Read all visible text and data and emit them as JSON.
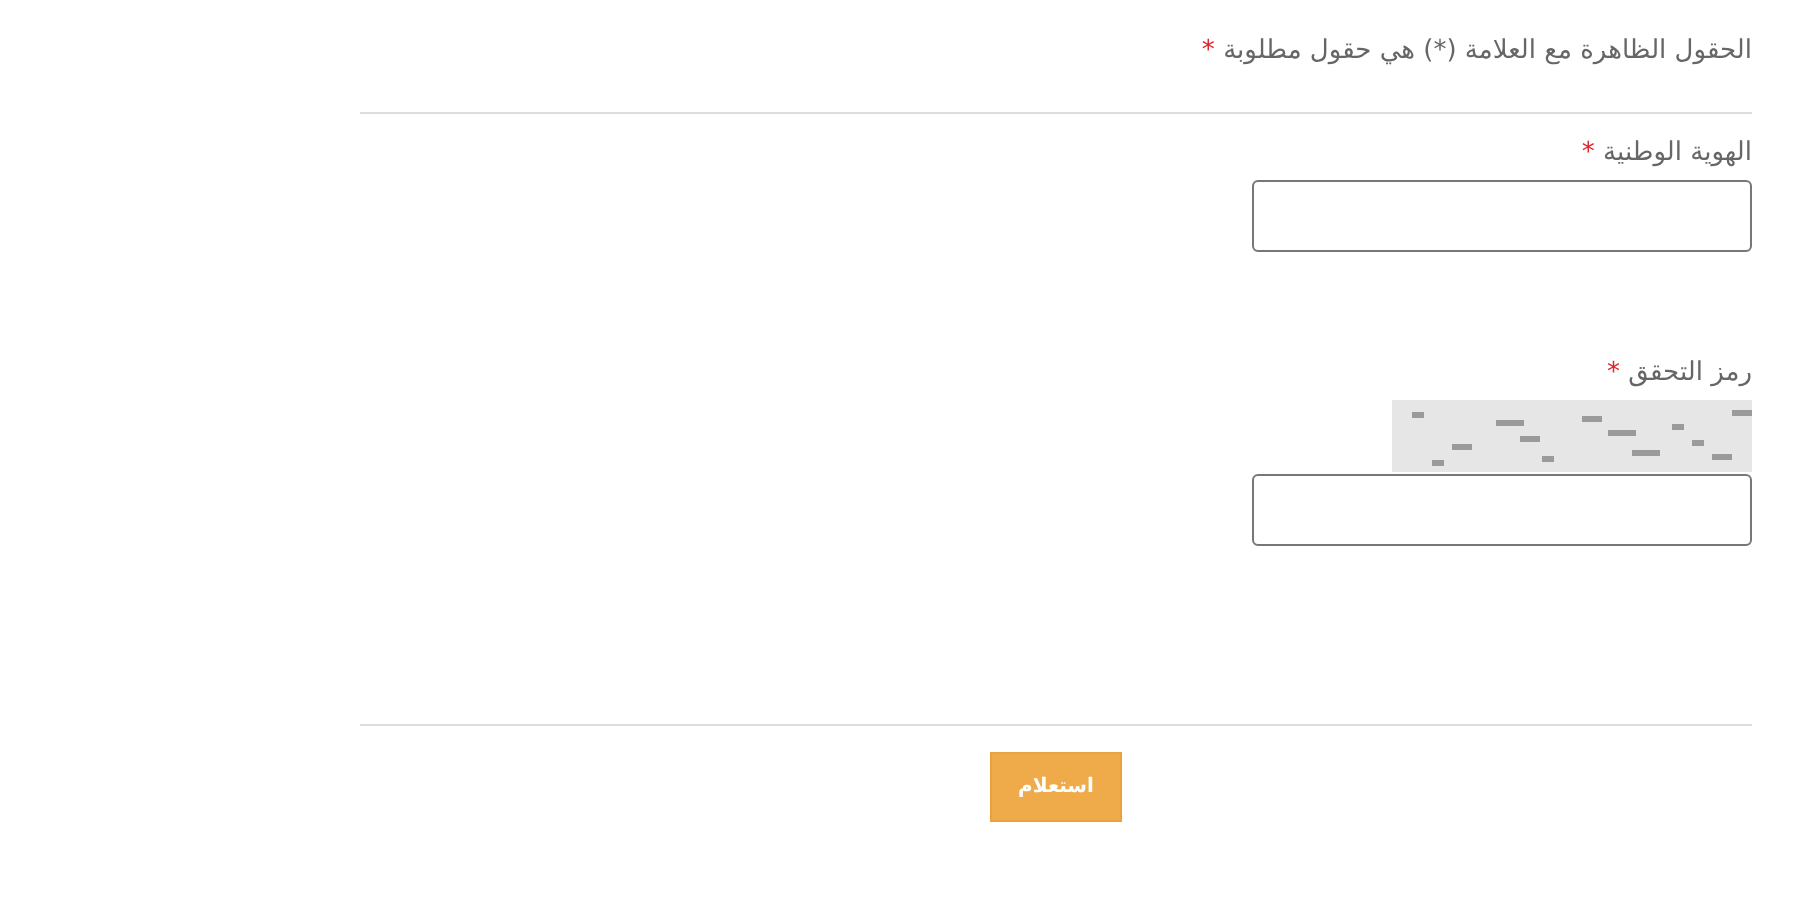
{
  "note": {
    "text": "الحقول الظاهرة مع العلامة (*) هي حقول مطلوبة",
    "marker": "*"
  },
  "fields": [
    {
      "kind": "text",
      "label": "الهوية الوطنية",
      "marker": "*"
    },
    {
      "kind": "captcha",
      "label": "رمز التحقق",
      "marker": "*"
    }
  ],
  "submit": {
    "label": "استعلام"
  }
}
